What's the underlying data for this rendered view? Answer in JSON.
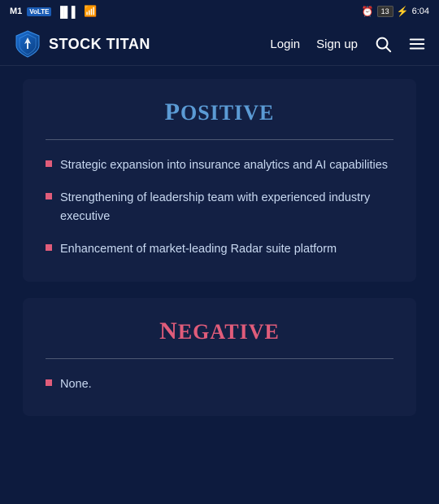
{
  "statusBar": {
    "carrier": "M1",
    "network": "VoLTE",
    "time": "6:04",
    "batteryNum": "13"
  },
  "header": {
    "logoText": "STOCK TITAN",
    "navLinks": [
      "Login",
      "Sign up"
    ]
  },
  "sections": [
    {
      "id": "positive",
      "title": "Positive",
      "capLetter": "P",
      "restTitle": "OSITIVE",
      "colorClass": "positive",
      "bullets": [
        "Strategic expansion into insurance analytics and AI capabilities",
        "Strengthening of leadership team with experienced industry executive",
        "Enhancement of market-leading Radar suite platform"
      ]
    },
    {
      "id": "negative",
      "title": "Negative",
      "capLetter": "N",
      "restTitle": "EGATIVE",
      "colorClass": "negative",
      "bullets": [
        "None."
      ]
    }
  ]
}
